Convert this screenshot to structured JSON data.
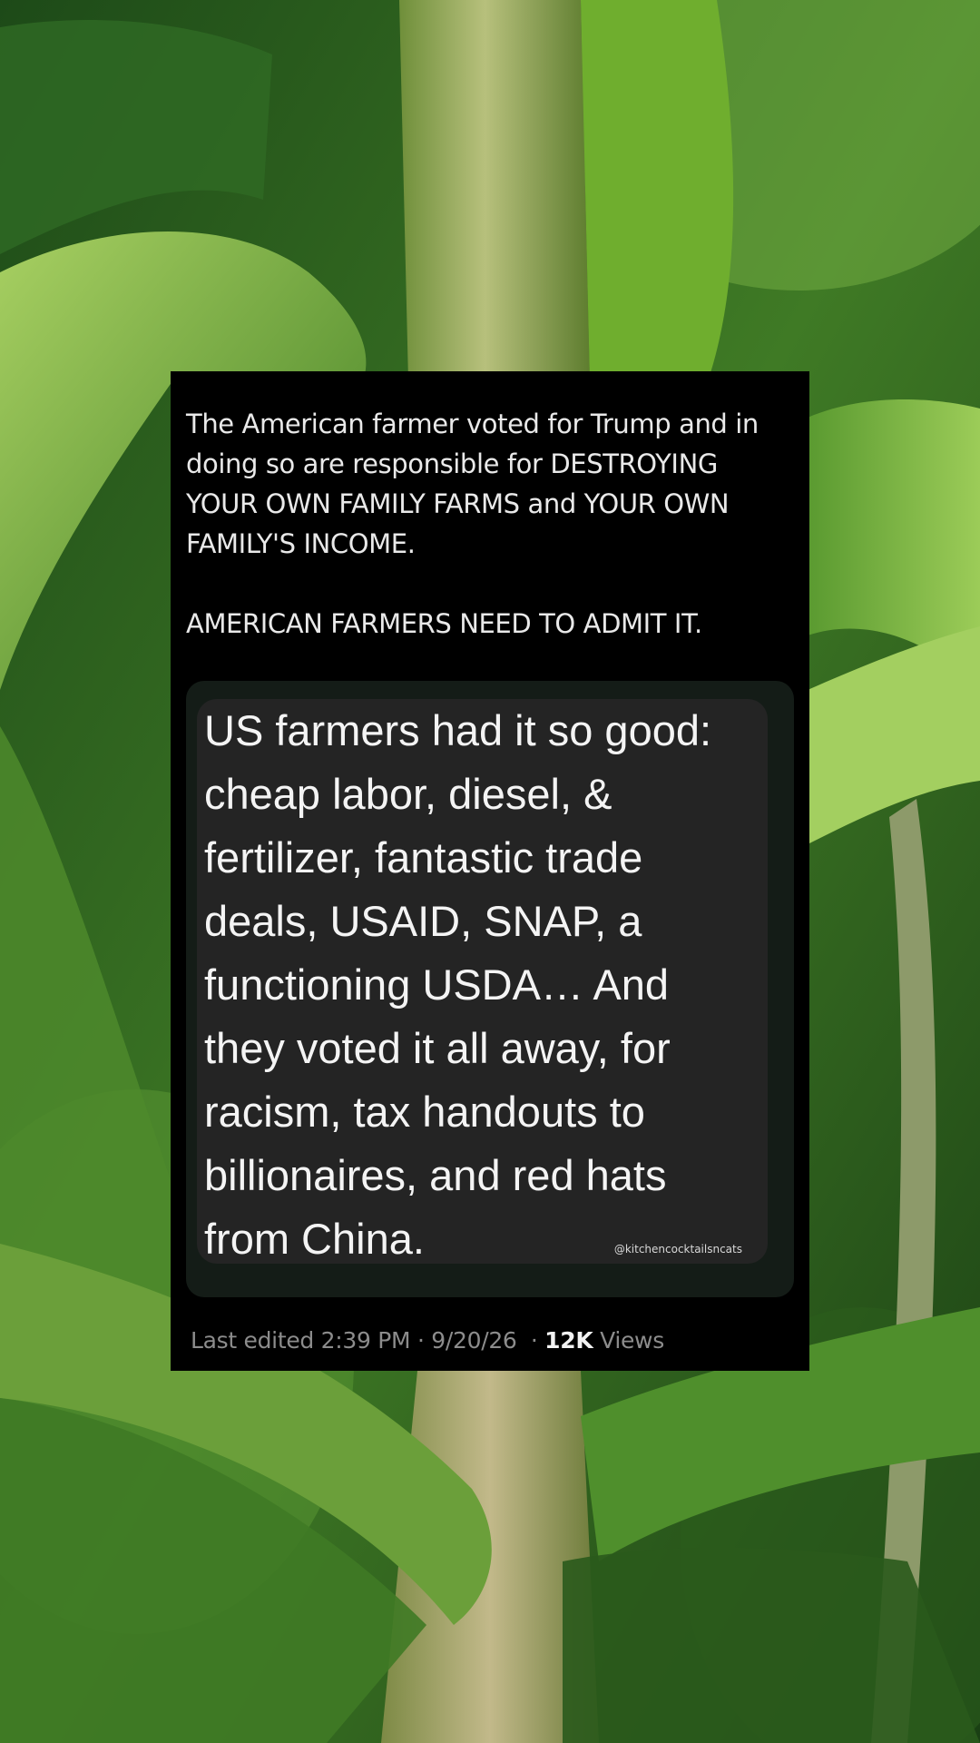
{
  "background": {
    "subject": "corn-stalk-leaves",
    "colors": {
      "dark_green": "#1f4a17",
      "mid_green": "#4f8a2c",
      "light_green": "#9cc45c",
      "stalk": "#a8b270"
    }
  },
  "post": {
    "text_lines": [
      "The American farmer voted for Trump and in",
      "doing so are responsible for DESTROYING",
      "YOUR OWN FAMILY FARMS and YOUR OWN",
      "FAMILY'S INCOME."
    ],
    "second_paragraph": "AMERICAN FARMERS NEED TO ADMIT IT."
  },
  "quote": {
    "lines": [
      "US farmers had it so good:",
      "cheap labor, diesel, &",
      "fertilizer, fantastic trade",
      "deals, USAID, SNAP, a",
      "functioning USDA… And",
      "they voted it all away, for",
      "racism, tax handouts to",
      "billionaires, and red hats",
      "from China."
    ],
    "watermark": "@kitchencocktailsncats"
  },
  "meta": {
    "edited_label": "Last edited",
    "time": "2:39 PM",
    "separator": "·",
    "date": "9/20/26",
    "views_count": "12K",
    "views_label": "Views"
  }
}
